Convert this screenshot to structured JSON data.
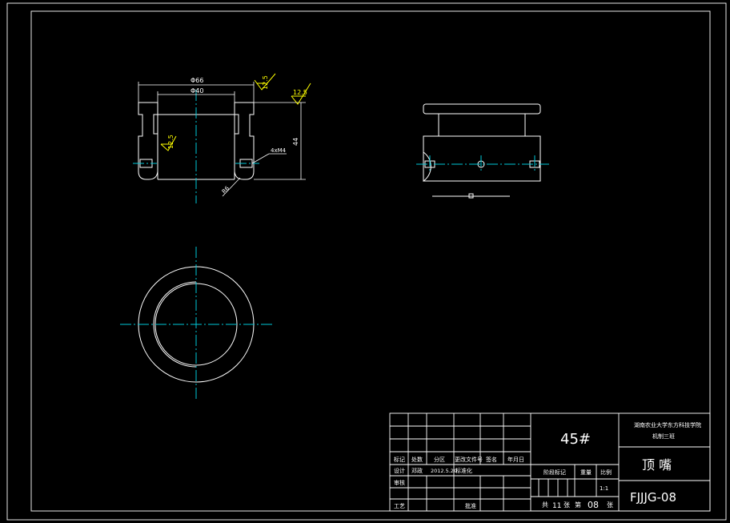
{
  "front_view": {
    "dia_outer": "Φ66",
    "dia_inner": "Φ40",
    "height": "44",
    "radius": "R6",
    "holes": "4xM4",
    "roughness_top": "12.5",
    "roughness_side": "12.5",
    "roughness_general": "12.5"
  },
  "title_block": {
    "material": "45#",
    "university": "湖南农业大学东方科技学院",
    "major": "机制三班",
    "part_name": "顶 嘴",
    "drawing_no": "FJJJG-08",
    "row1": [
      "标记",
      "处数",
      "分区",
      "更改文件号",
      "签名",
      "年月日"
    ],
    "row2": [
      "设计",
      "邓政",
      "2012.5.20",
      "标准化"
    ],
    "review_label": "审核",
    "process_label": "工艺",
    "approve_label": "批准",
    "stage_label": "阶段标记",
    "weight_label": "重量",
    "scale_label": "比例",
    "scale_value": "1:1",
    "total_sheets_prefix": "共",
    "total_sheets": "11",
    "total_sheets_unit": "张",
    "sheet_prefix": "第",
    "sheet_no": "08",
    "sheet_unit": "张"
  }
}
